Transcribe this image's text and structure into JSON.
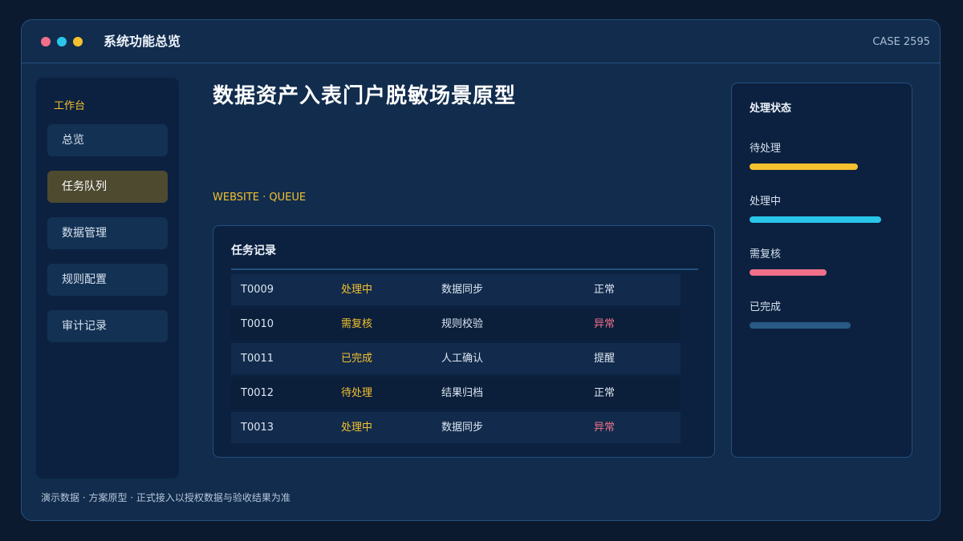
{
  "window": {
    "title": "系统功能总览",
    "case_id": "CASE 2595"
  },
  "sidebar": {
    "heading": "工作台",
    "items": [
      {
        "label": "总览",
        "active": false
      },
      {
        "label": "任务队列",
        "active": true
      },
      {
        "label": "数据管理",
        "active": false
      },
      {
        "label": "规则配置",
        "active": false
      },
      {
        "label": "审计记录",
        "active": false
      }
    ]
  },
  "main": {
    "title": "数据资产入表门户脱敏场景原型",
    "subtitle": "WEBSITE · QUEUE"
  },
  "task_table": {
    "heading": "任务记录",
    "rows": [
      {
        "id": "T0009",
        "status": "处理中",
        "task": "数据同步",
        "result": "正常",
        "result_alert": false
      },
      {
        "id": "T0010",
        "status": "需复核",
        "task": "规则校验",
        "result": "异常",
        "result_alert": true
      },
      {
        "id": "T0011",
        "status": "已完成",
        "task": "人工确认",
        "result": "提醒",
        "result_alert": false
      },
      {
        "id": "T0012",
        "status": "待处理",
        "task": "结果归档",
        "result": "正常",
        "result_alert": false
      },
      {
        "id": "T0013",
        "status": "处理中",
        "task": "数据同步",
        "result": "异常",
        "result_alert": true
      }
    ]
  },
  "status_panel": {
    "heading": "处理状态",
    "items": [
      {
        "label": "待处理",
        "fraction": 0.74,
        "color": "#f5c12e"
      },
      {
        "label": "处理中",
        "fraction": 0.9,
        "color": "#29c6ea"
      },
      {
        "label": "需复核",
        "fraction": 0.53,
        "color": "#f0708a"
      },
      {
        "label": "已完成",
        "fraction": 0.69,
        "color": "#285a85"
      }
    ]
  },
  "footer": {
    "note": "演示数据 · 方案原型 · 正式接入以授权数据与验收结果为准"
  },
  "colors": {
    "accent": "#f5c12e",
    "alert": "#f0708a",
    "window_dot_red": "#f0708a",
    "window_dot_cyan": "#29c6ea",
    "window_dot_yellow": "#f5c12e"
  }
}
